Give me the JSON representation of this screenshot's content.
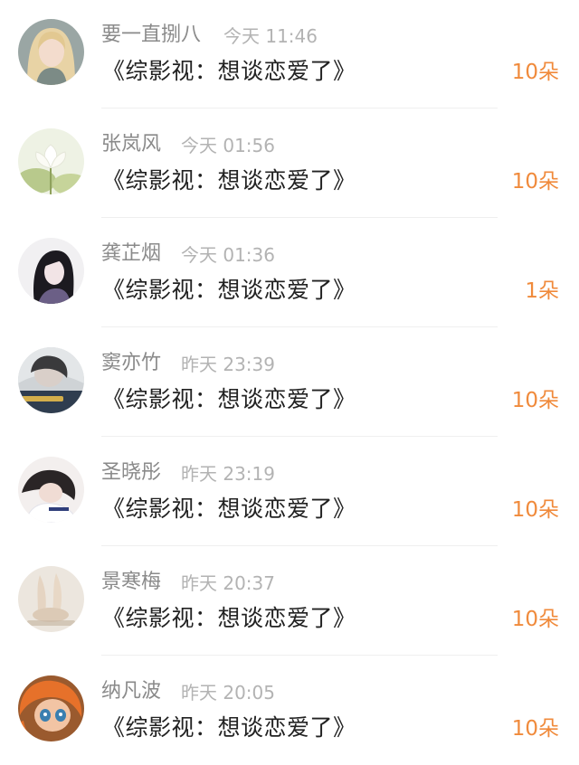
{
  "items": [
    {
      "name": "要一直捌八",
      "time": "今天 11:46",
      "title": "《综影视：想谈恋爱了》",
      "gift": "10朵"
    },
    {
      "name": "张岚风",
      "time": "今天 01:56",
      "title": "《综影视：想谈恋爱了》",
      "gift": "10朵"
    },
    {
      "name": "龚芷烟",
      "time": "今天 01:36",
      "title": "《综影视：想谈恋爱了》",
      "gift": "1朵"
    },
    {
      "name": "窦亦竹",
      "time": "昨天 23:39",
      "title": "《综影视：想谈恋爱了》",
      "gift": "10朵"
    },
    {
      "name": "圣晓彤",
      "time": "昨天 23:19",
      "title": "《综影视：想谈恋爱了》",
      "gift": "10朵"
    },
    {
      "name": "景寒梅",
      "time": "昨天 20:37",
      "title": "《综影视：想谈恋爱了》",
      "gift": "10朵"
    },
    {
      "name": "纳凡波",
      "time": "昨天 20:05",
      "title": "《综影视：想谈恋爱了》",
      "gift": "10朵"
    }
  ],
  "colors": {
    "name": "#8a8a8a",
    "time": "#b3b3b3",
    "title": "#222222",
    "gift": "#f08a3b"
  }
}
